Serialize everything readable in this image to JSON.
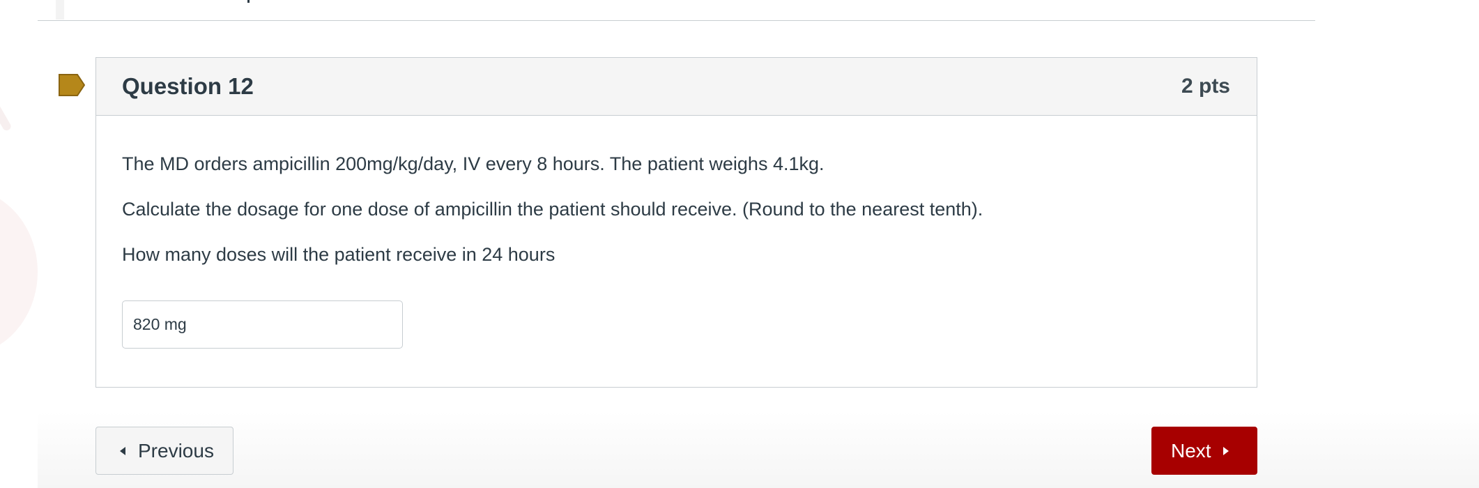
{
  "question": {
    "title": "Question 12",
    "points": "2 pts",
    "flag_icon": "flag-icon",
    "flag_color": "#b5871a",
    "paragraphs": [
      "The MD orders ampicillin 200mg/kg/day, IV every 8 hours.  The patient weighs 4.1kg.",
      "Calculate the dosage for one dose of ampicillin the patient should receive. (Round to the nearest tenth).",
      "How many doses will the patient receive in 24 hours"
    ],
    "answer_value": "820 mg"
  },
  "navigation": {
    "previous_label": "Previous",
    "previous_icon": "caret-left-icon",
    "next_label": "Next",
    "next_icon": "caret-right-icon",
    "next_color": "#a70000"
  }
}
